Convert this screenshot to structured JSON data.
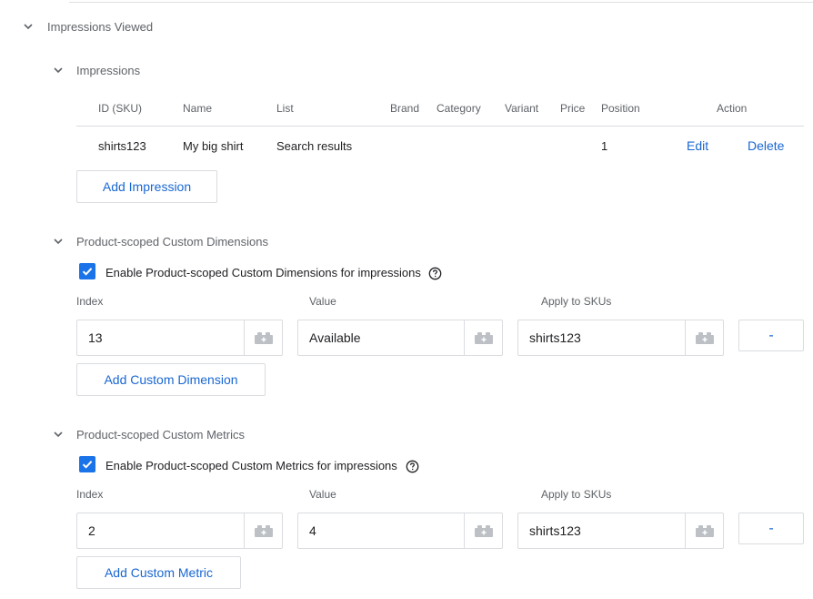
{
  "impressions_viewed": {
    "title": "Impressions Viewed",
    "impressions": {
      "title": "Impressions",
      "headers": {
        "id": "ID (SKU)",
        "name": "Name",
        "list": "List",
        "brand": "Brand",
        "category": "Category",
        "variant": "Variant",
        "price": "Price",
        "position": "Position",
        "action": "Action"
      },
      "rows": [
        {
          "id": "shirts123",
          "name": "My big shirt",
          "list": "Search results",
          "brand": "",
          "category": "",
          "variant": "",
          "price": "",
          "position": "1",
          "edit": "Edit",
          "delete": "Delete"
        }
      ],
      "add_button": "Add Impression"
    },
    "dimensions": {
      "title": "Product-scoped Custom Dimensions",
      "checkbox_label": "Enable Product-scoped Custom Dimensions for impressions",
      "checked": true,
      "labels": {
        "index": "Index",
        "value": "Value",
        "apply": "Apply to SKUs"
      },
      "row": {
        "index": "13",
        "value": "Available",
        "apply": "shirts123",
        "remove": "-"
      },
      "add_button": "Add Custom Dimension"
    },
    "metrics": {
      "title": "Product-scoped Custom Metrics",
      "checkbox_label": "Enable Product-scoped Custom Metrics for impressions",
      "checked": true,
      "labels": {
        "index": "Index",
        "value": "Value",
        "apply": "Apply to SKUs"
      },
      "row": {
        "index": "2",
        "value": "4",
        "apply": "shirts123",
        "remove": "-"
      },
      "add_button": "Add Custom Metric"
    }
  },
  "icons": {
    "collapse": "chevron-down-icon",
    "help": "help-circle-icon",
    "variable": "variable-brick-icon",
    "check": "check-icon"
  },
  "colors": {
    "accent": "#1967d2",
    "checkbox": "#1a73e8",
    "border": "#dadce0",
    "muted_text": "#5f6368"
  }
}
